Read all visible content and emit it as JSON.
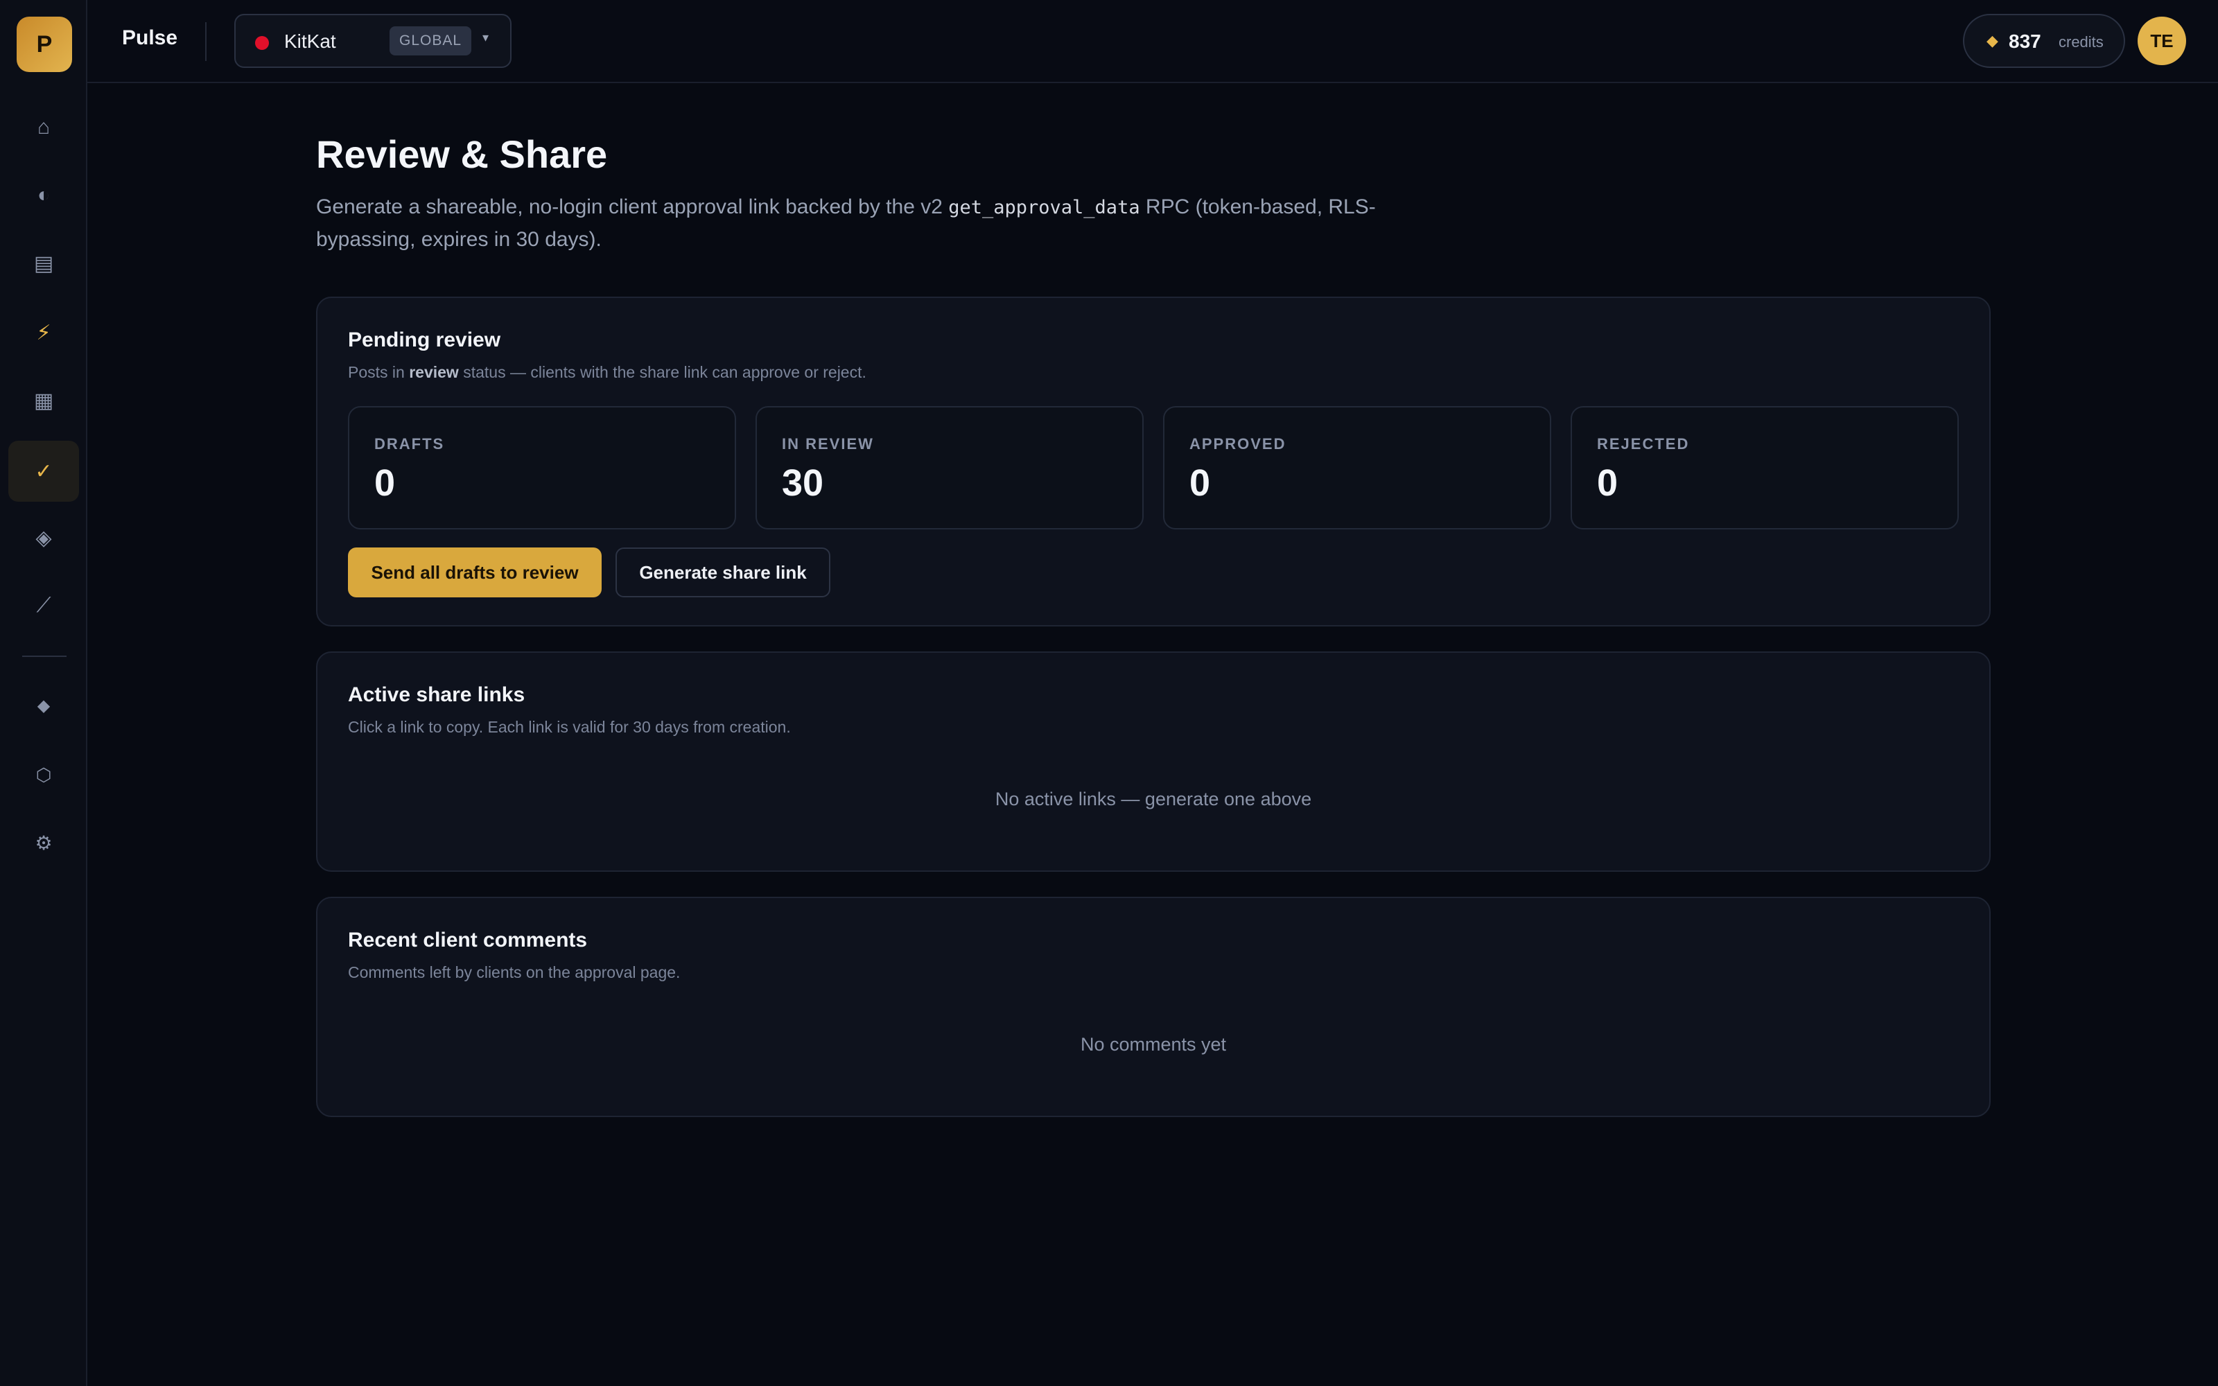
{
  "app": {
    "brand": "Pulse",
    "logo_letter": "P"
  },
  "workspace": {
    "name": "KitKat",
    "badge": "GLOBAL",
    "status_color": "#e0102a"
  },
  "credits": {
    "value": "837",
    "label": "credits"
  },
  "user": {
    "initials": "TE"
  },
  "sidebar": {
    "items": [
      {
        "icon": "home-icon",
        "glyph": "⌂"
      },
      {
        "icon": "contrast-icon",
        "glyph": "◐"
      },
      {
        "icon": "document-icon",
        "glyph": "▤"
      },
      {
        "icon": "lightning-icon",
        "glyph": "⚡"
      },
      {
        "icon": "grid-icon",
        "glyph": "▦"
      },
      {
        "icon": "checkmark-icon",
        "glyph": "✓",
        "active": true
      },
      {
        "icon": "diamond-icon",
        "glyph": "◈"
      },
      {
        "icon": "trend-icon",
        "glyph": "⟋"
      },
      {
        "icon": "gem-icon",
        "glyph": "◆"
      },
      {
        "icon": "hexagon-icon",
        "glyph": "⬡"
      },
      {
        "icon": "settings-icon",
        "glyph": "⚙"
      }
    ]
  },
  "page": {
    "title": "Review & Share",
    "desc_pre": "Generate a shareable, no-login client approval link backed by the v2 ",
    "desc_code": "get_approval_data",
    "desc_post": " RPC (token-based, RLS-bypassing, expires in 30 days)."
  },
  "pending": {
    "title": "Pending review",
    "sub_pre": "Posts in ",
    "sub_bold": "review",
    "sub_post": " status — clients with the share link can approve or reject.",
    "stats": [
      {
        "label": "DRAFTS",
        "value": "0"
      },
      {
        "label": "IN REVIEW",
        "value": "30"
      },
      {
        "label": "APPROVED",
        "value": "0"
      },
      {
        "label": "REJECTED",
        "value": "0"
      }
    ],
    "send_button": "Send all drafts to review",
    "generate_button": "Generate share link"
  },
  "links": {
    "title": "Active share links",
    "sub": "Click a link to copy. Each link is valid for 30 days from creation.",
    "empty": "No active links — generate one above"
  },
  "comments": {
    "title": "Recent client comments",
    "sub": "Comments left by clients on the approval page.",
    "empty": "No comments yet"
  },
  "colors": {
    "accent": "#d9a83d",
    "background": "#070a12",
    "card": "#0e121d"
  }
}
